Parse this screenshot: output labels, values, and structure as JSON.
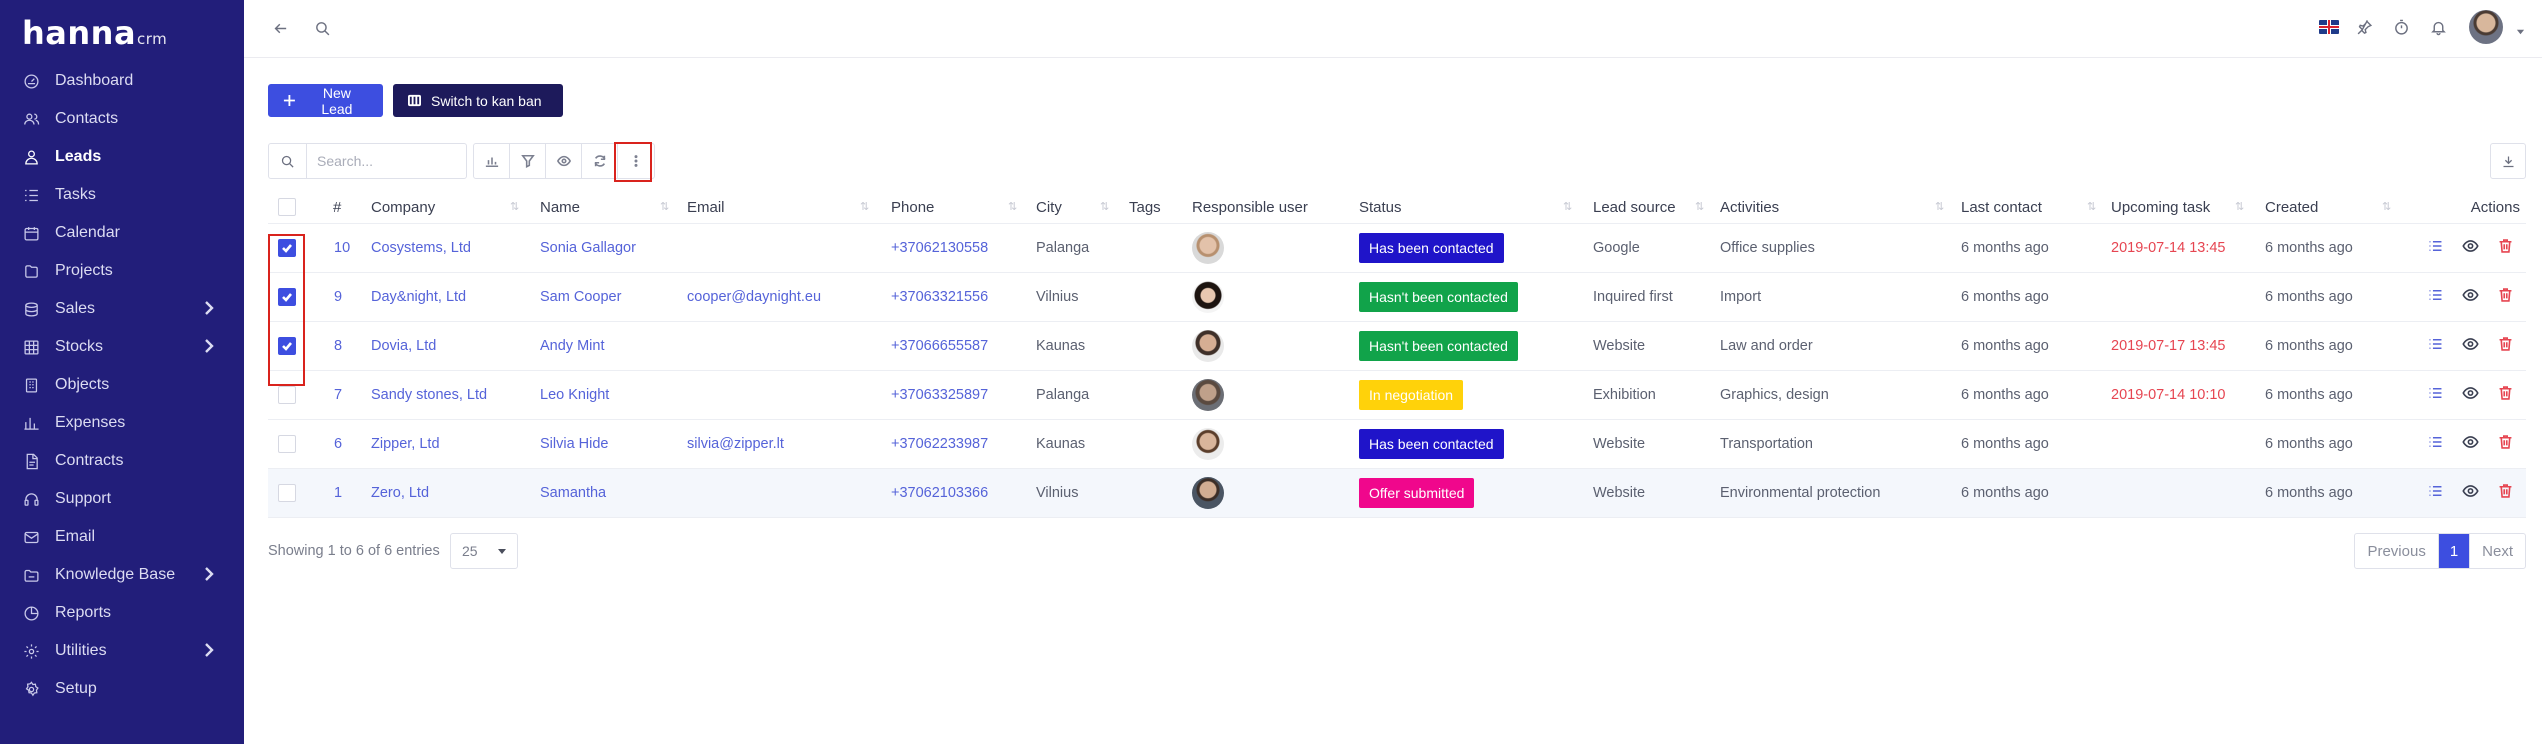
{
  "app": {
    "logo_main": "hanna",
    "logo_sub": "crm"
  },
  "sidebar": {
    "items": [
      {
        "label": "Dashboard",
        "icon": "dashboard-icon",
        "active": false,
        "arrow": false
      },
      {
        "label": "Contacts",
        "icon": "contacts-icon",
        "active": false,
        "arrow": false
      },
      {
        "label": "Leads",
        "icon": "leads-icon",
        "active": true,
        "arrow": false
      },
      {
        "label": "Tasks",
        "icon": "tasks-icon",
        "active": false,
        "arrow": false
      },
      {
        "label": "Calendar",
        "icon": "calendar-icon",
        "active": false,
        "arrow": false
      },
      {
        "label": "Projects",
        "icon": "projects-icon",
        "active": false,
        "arrow": false
      },
      {
        "label": "Sales",
        "icon": "sales-icon",
        "active": false,
        "arrow": true
      },
      {
        "label": "Stocks",
        "icon": "stocks-icon",
        "active": false,
        "arrow": true
      },
      {
        "label": "Objects",
        "icon": "objects-icon",
        "active": false,
        "arrow": false
      },
      {
        "label": "Expenses",
        "icon": "expenses-icon",
        "active": false,
        "arrow": false
      },
      {
        "label": "Contracts",
        "icon": "contracts-icon",
        "active": false,
        "arrow": false
      },
      {
        "label": "Support",
        "icon": "support-icon",
        "active": false,
        "arrow": false
      },
      {
        "label": "Email",
        "icon": "email-icon",
        "active": false,
        "arrow": false
      },
      {
        "label": "Knowledge Base",
        "icon": "knowledge-base-icon",
        "active": false,
        "arrow": true
      },
      {
        "label": "Reports",
        "icon": "reports-icon",
        "active": false,
        "arrow": false
      },
      {
        "label": "Utilities",
        "icon": "utilities-icon",
        "active": false,
        "arrow": true
      },
      {
        "label": "Setup",
        "icon": "setup-icon",
        "active": false,
        "arrow": false
      }
    ]
  },
  "toolbar": {
    "new_lead": "New Lead",
    "switch_kanban": "Switch to kan ban",
    "search_placeholder": "Search..."
  },
  "table": {
    "columns": {
      "num": "#",
      "company": "Company",
      "name": "Name",
      "email": "Email",
      "phone": "Phone",
      "city": "City",
      "tags": "Tags",
      "responsible": "Responsible user",
      "status": "Status",
      "source": "Lead source",
      "activities": "Activities",
      "last_contact": "Last contact",
      "upcoming": "Upcoming task",
      "created": "Created",
      "actions": "Actions"
    },
    "rows": [
      {
        "checked": true,
        "num": "10",
        "company": "Cosystems, Ltd",
        "name": "Sonia Gallagor",
        "email": "",
        "phone": "+37062130558",
        "city": "Palanga",
        "status": "Has been contacted",
        "status_color": "#1f14c9",
        "source": "Google",
        "activities": "Office supplies",
        "last_contact": "6 months ago",
        "upcoming": "2019-07-14 13:45",
        "created": "6 months ago",
        "avatar": "avatar-female-glasses"
      },
      {
        "checked": true,
        "num": "9",
        "company": "Day&night, Ltd",
        "name": "Sam Cooper",
        "email": "cooper@daynight.eu",
        "phone": "+37063321556",
        "city": "Vilnius",
        "status": "Hasn't been contacted",
        "status_color": "#11a34a",
        "source": "Inquired first",
        "activities": "Import",
        "last_contact": "6 months ago",
        "upcoming": "",
        "created": "6 months ago",
        "avatar": "avatar-female-dark-hair"
      },
      {
        "checked": true,
        "num": "8",
        "company": "Dovia, Ltd",
        "name": "Andy Mint",
        "email": "",
        "phone": "+37066655587",
        "city": "Kaunas",
        "status": "Hasn't been contacted",
        "status_color": "#11a34a",
        "source": "Website",
        "activities": "Law and order",
        "last_contact": "6 months ago",
        "upcoming": "2019-07-17 13:45",
        "created": "6 months ago",
        "avatar": "avatar-male-beard"
      },
      {
        "checked": false,
        "num": "7",
        "company": "Sandy stones, Ltd",
        "name": "Leo Knight",
        "email": "",
        "phone": "+37063325897",
        "city": "Palanga",
        "status": "In negotiation",
        "status_color": "#ffd20a",
        "source": "Exhibition",
        "activities": "Graphics, design",
        "last_contact": "6 months ago",
        "upcoming": "2019-07-14 10:10",
        "created": "6 months ago",
        "avatar": "avatar-male-grey"
      },
      {
        "checked": false,
        "num": "6",
        "company": "Zipper, Ltd",
        "name": "Silvia Hide",
        "email": "silvia@zipper.lt",
        "phone": "+37062233987",
        "city": "Kaunas",
        "status": "Has been contacted",
        "status_color": "#1f14c9",
        "source": "Website",
        "activities": "Transportation",
        "last_contact": "6 months ago",
        "upcoming": "",
        "created": "6 months ago",
        "avatar": "avatar-male-smiling"
      },
      {
        "checked": false,
        "num": "1",
        "company": "Zero, Ltd",
        "name": "Samantha",
        "email": "",
        "phone": "+37062103366",
        "city": "Vilnius",
        "status": "Offer submitted",
        "status_color": "#f0078c",
        "source": "Website",
        "activities": "Environmental protection",
        "last_contact": "6 months ago",
        "upcoming": "",
        "created": "6 months ago",
        "avatar": "avatar-male-suit"
      }
    ]
  },
  "footer": {
    "showing": "Showing 1 to 6 of 6 entries",
    "page_size": "25",
    "previous": "Previous",
    "page": "1",
    "next": "Next"
  }
}
